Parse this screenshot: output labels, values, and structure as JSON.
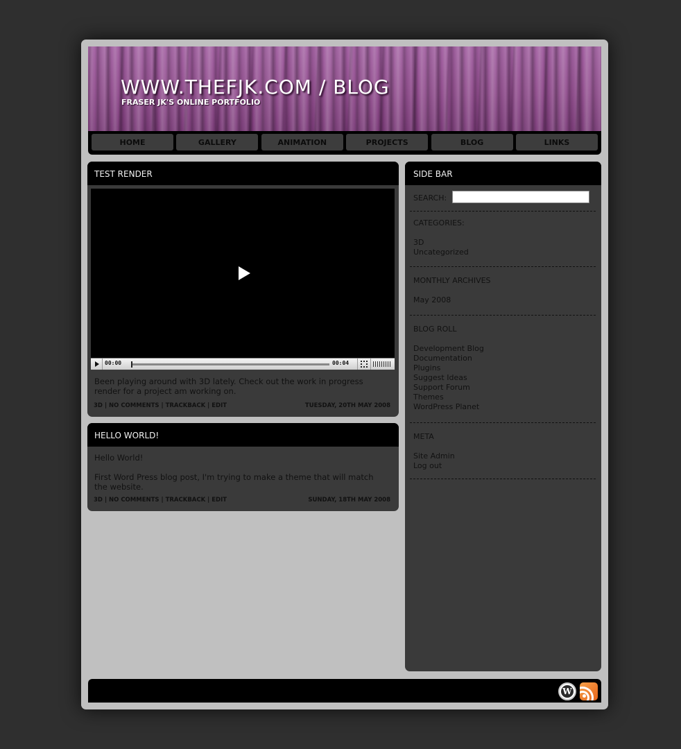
{
  "header": {
    "title": "WWW.THEFJK.COM / BLOG",
    "subtitle": "FRASER JK'S ONLINE PORTFOLIO"
  },
  "nav": {
    "items": [
      "HOME",
      "GALLERY",
      "ANIMATION",
      "PROJECTS",
      "BLOG",
      "LINKS"
    ]
  },
  "posts": [
    {
      "title": "TEST RENDER",
      "video": {
        "current_time": "00:00",
        "duration": "00:04"
      },
      "body": "Been playing around with 3D lately. Check out the work in progress render for a project am working on.",
      "meta": {
        "category": "3D",
        "comments": "NO COMMENTS",
        "trackback": "TRACKBACK",
        "edit": "EDIT",
        "date": "TUESDAY, 20TH MAY 2008"
      }
    },
    {
      "title": "HELLO WORLD!",
      "body1": "Hello World!",
      "body2": "First Word Press blog post, I'm trying to make a theme that will match the website.",
      "meta": {
        "category": "3D",
        "comments": "NO COMMENTS",
        "trackback": "TRACKBACK",
        "edit": "EDIT",
        "date": "SUNDAY, 18TH MAY 2008"
      }
    }
  ],
  "sidebar": {
    "title": "SIDE BAR",
    "search_label": "SEARCH:",
    "search_value": "",
    "categories": {
      "label": "CATEGORIES:",
      "items": [
        "3D",
        "Uncategorized"
      ]
    },
    "archives": {
      "label": "MONTHLY ARCHIVES",
      "items": [
        "May 2008"
      ]
    },
    "blogroll": {
      "label": "BLOG ROLL",
      "items": [
        "Development Blog",
        "Documentation",
        "Plugins",
        "Suggest Ideas",
        "Support Forum",
        "Themes",
        "WordPress Planet"
      ]
    },
    "meta": {
      "label": "META",
      "items": [
        "Site Admin",
        "Log out"
      ]
    }
  },
  "footer": {
    "icons": [
      "wordpress-icon",
      "rss-icon"
    ]
  },
  "colors": {
    "background": "#2f2f2f",
    "page": "#c0c0c0",
    "panel": "#3a3a3a",
    "bar": "#000000",
    "header_purple": "#8f4b8c"
  }
}
